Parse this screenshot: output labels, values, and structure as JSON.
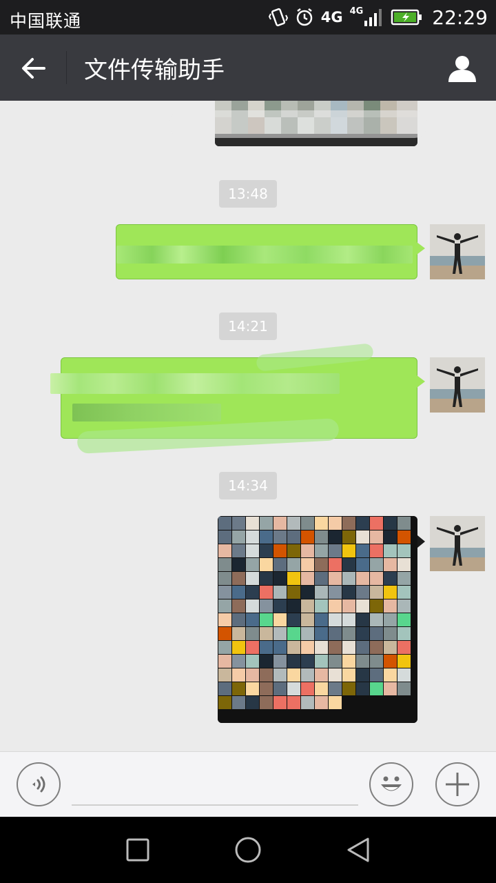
{
  "status_bar": {
    "carrier": "中国联通",
    "network_large": "4G",
    "network_small": "4G",
    "time": "22:29",
    "icons": [
      "vibrate-icon",
      "alarm-icon",
      "signal-icon",
      "battery-charging-icon"
    ]
  },
  "title_bar": {
    "title": "文件传输助手",
    "back_icon": "back-arrow-icon",
    "profile_icon": "person-icon"
  },
  "messages": [
    {
      "type": "image",
      "content": "pixelated-image-top",
      "sender": "self"
    },
    {
      "type": "timestamp",
      "text": "13:48"
    },
    {
      "type": "text",
      "sender": "self",
      "text": "",
      "redacted": true
    },
    {
      "type": "timestamp",
      "text": "14:21"
    },
    {
      "type": "text",
      "sender": "self",
      "text": "",
      "redacted": true
    },
    {
      "type": "timestamp",
      "text": "14:34"
    },
    {
      "type": "image",
      "sender": "self",
      "content": "avatar-collage-image"
    }
  ],
  "input_bar": {
    "voice_icon": "voice-icon",
    "emoji_icon": "emoji-icon",
    "plus_icon": "plus-icon",
    "placeholder": ""
  },
  "nav_bar": {
    "icons": [
      "recent-apps-icon",
      "home-icon",
      "back-icon"
    ]
  },
  "colors": {
    "title_bar": "#393a3f",
    "status_bar": "#1d1d1f",
    "chat_bg": "#ebebeb",
    "bubble": "#9fe658",
    "timestamp_bg": "#d5d5d5"
  }
}
